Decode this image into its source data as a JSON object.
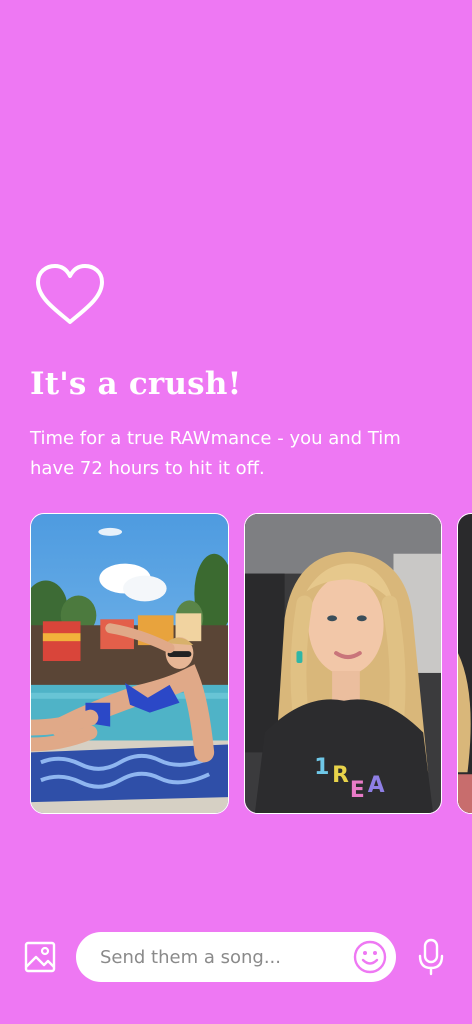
{
  "colors": {
    "background": "#EE78F3",
    "foreground": "#FFFFFF",
    "input_background": "#FFFFFF",
    "accent": "#EE78F3"
  },
  "header": {
    "icon": "heart-outline-icon",
    "title": "It's a crush!",
    "subtitle": "Time for a true RAWmance - you and Tim have 72 hours to hit it off."
  },
  "photos": [
    {
      "name": "photo-woman-poolside",
      "description_icon": "photo"
    },
    {
      "name": "photo-woman-selfie-car",
      "description_icon": "photo"
    },
    {
      "name": "photo-partial",
      "description_icon": "photo"
    }
  ],
  "composer": {
    "image_button_icon": "image-icon",
    "placeholder": "Send them a song...",
    "value": "",
    "emoji_button_icon": "smiley-icon",
    "mic_button_icon": "microphone-icon"
  }
}
